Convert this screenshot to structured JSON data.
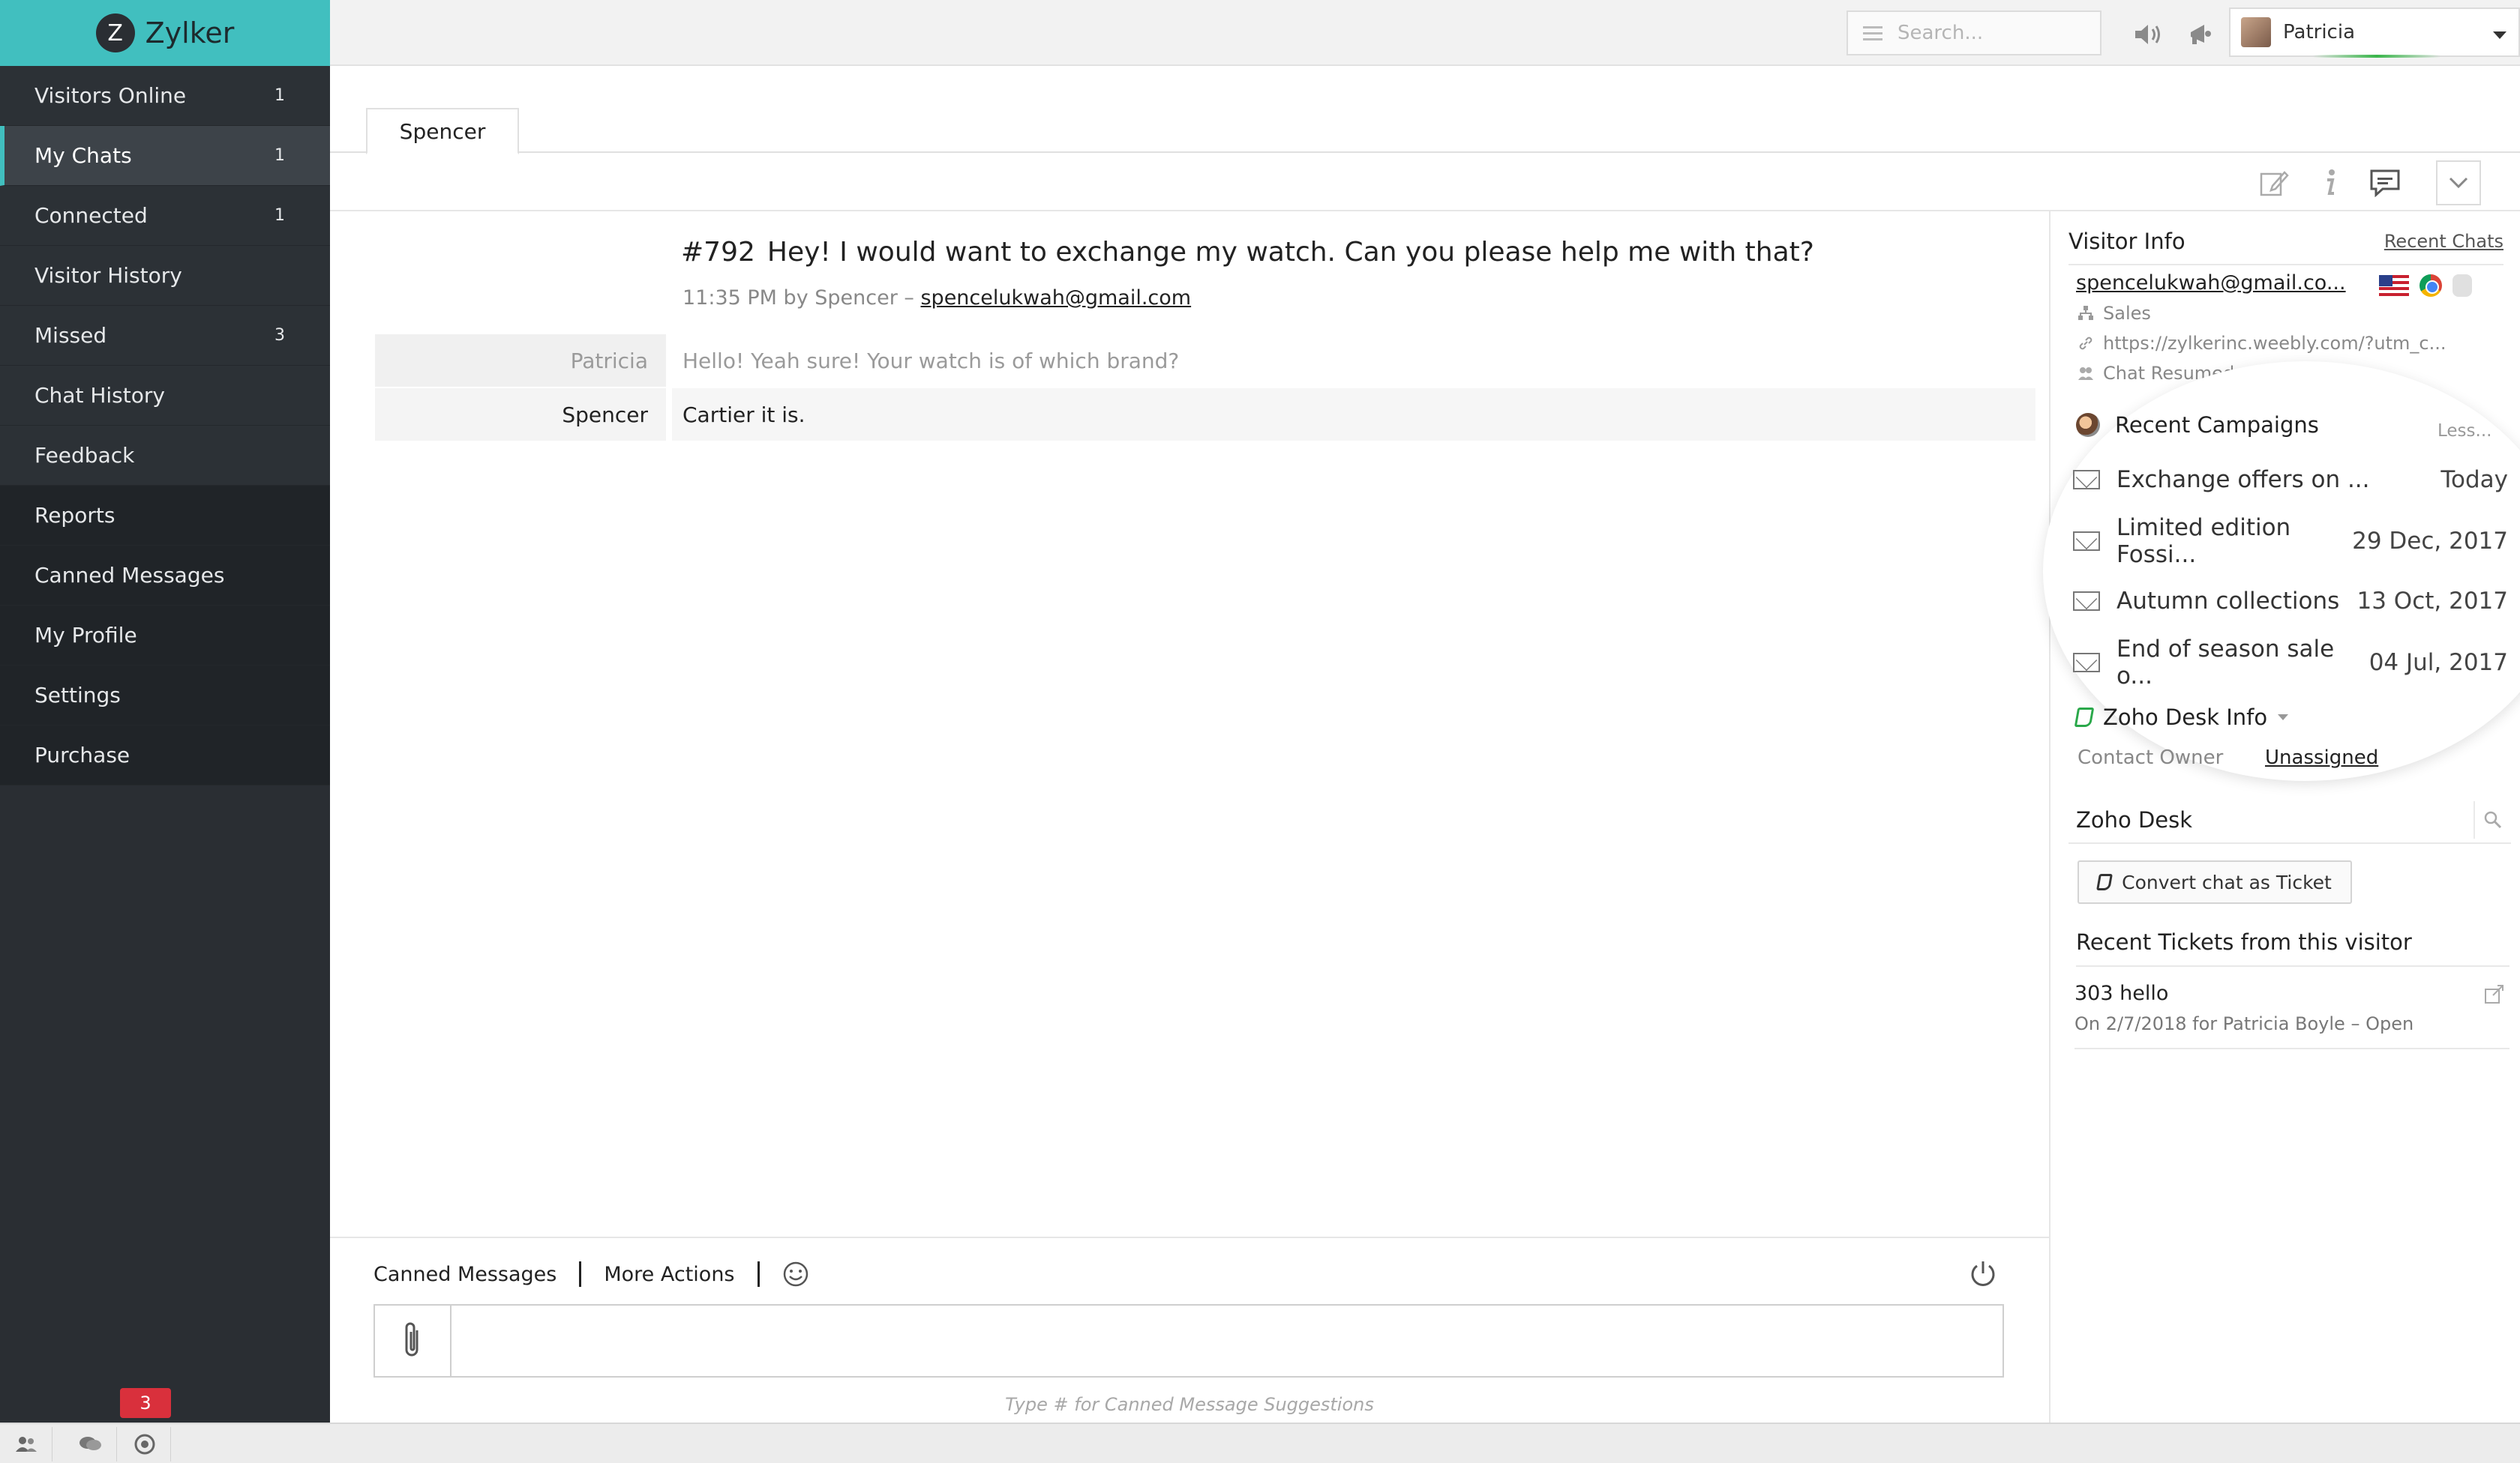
{
  "brand": {
    "logo_letter": "Z",
    "name": "Zylker"
  },
  "sidebar": {
    "items": [
      {
        "label": "Visitors Online",
        "count": "1"
      },
      {
        "label": "My Chats",
        "count": "1"
      },
      {
        "label": "Connected",
        "count": "1"
      },
      {
        "label": "Visitor History",
        "count": ""
      },
      {
        "label": "Missed",
        "count": "3"
      },
      {
        "label": "Chat History",
        "count": ""
      },
      {
        "label": "Feedback",
        "count": ""
      },
      {
        "label": "Reports",
        "count": ""
      },
      {
        "label": "Canned Messages",
        "count": ""
      },
      {
        "label": "My Profile",
        "count": ""
      },
      {
        "label": "Settings",
        "count": ""
      },
      {
        "label": "Purchase",
        "count": ""
      }
    ],
    "active": "My Chats"
  },
  "bottombar": {
    "badge": "3"
  },
  "topbar": {
    "search_placeholder": "Search...",
    "user_name": "Patricia",
    "icons": [
      "sound-icon",
      "megaphone-icon"
    ]
  },
  "tabs": [
    {
      "label": "Spencer"
    }
  ],
  "chat": {
    "id": "#792",
    "question": "Hey! I would want to exchange my watch. Can you please help me with that?",
    "meta_prefix": "11:35 PM by Spencer – ",
    "meta_email": "spencelukwah@gmail.com",
    "messages": [
      {
        "sender": "Patricia",
        "text": "Hello! Yeah sure! Your watch is of which brand?"
      },
      {
        "sender": "Spencer",
        "text": "Cartier it is."
      }
    ]
  },
  "composer": {
    "canned_label": "Canned Messages",
    "more_label": "More Actions",
    "input_value": "",
    "hint": "Type # for Canned Message Suggestions"
  },
  "visitor_info": {
    "title": "Visitor Info",
    "recent_chats_link": "Recent Chats",
    "email": "spencelukwah@gmail.co...",
    "department": "Sales",
    "url": "https://zylkerinc.weebly.com/?utm_c...",
    "status": "Chat Resumed"
  },
  "campaigns": {
    "title": "Recent Campaigns",
    "toggle": "Less...",
    "items": [
      {
        "name": "Exchange offers on ...",
        "date": "Today"
      },
      {
        "name": "Limited edition Fossi...",
        "date": "29 Dec, 2017"
      },
      {
        "name": "Autumn collections",
        "date": "13 Oct, 2017"
      },
      {
        "name": "End of season sale o...",
        "date": "04 Jul, 2017"
      }
    ]
  },
  "zoho_desk_info": {
    "title": "Zoho Desk Info",
    "owner_label": "Contact Owner",
    "owner_value": "Unassigned"
  },
  "zoho_desk": {
    "title": "Zoho Desk",
    "convert_button": "Convert chat as Ticket",
    "recent_tickets_title": "Recent Tickets from this visitor",
    "tickets": [
      {
        "id_subject": "303 hello",
        "meta": "On 2/7/2018  for Patricia Boyle – Open"
      }
    ]
  }
}
